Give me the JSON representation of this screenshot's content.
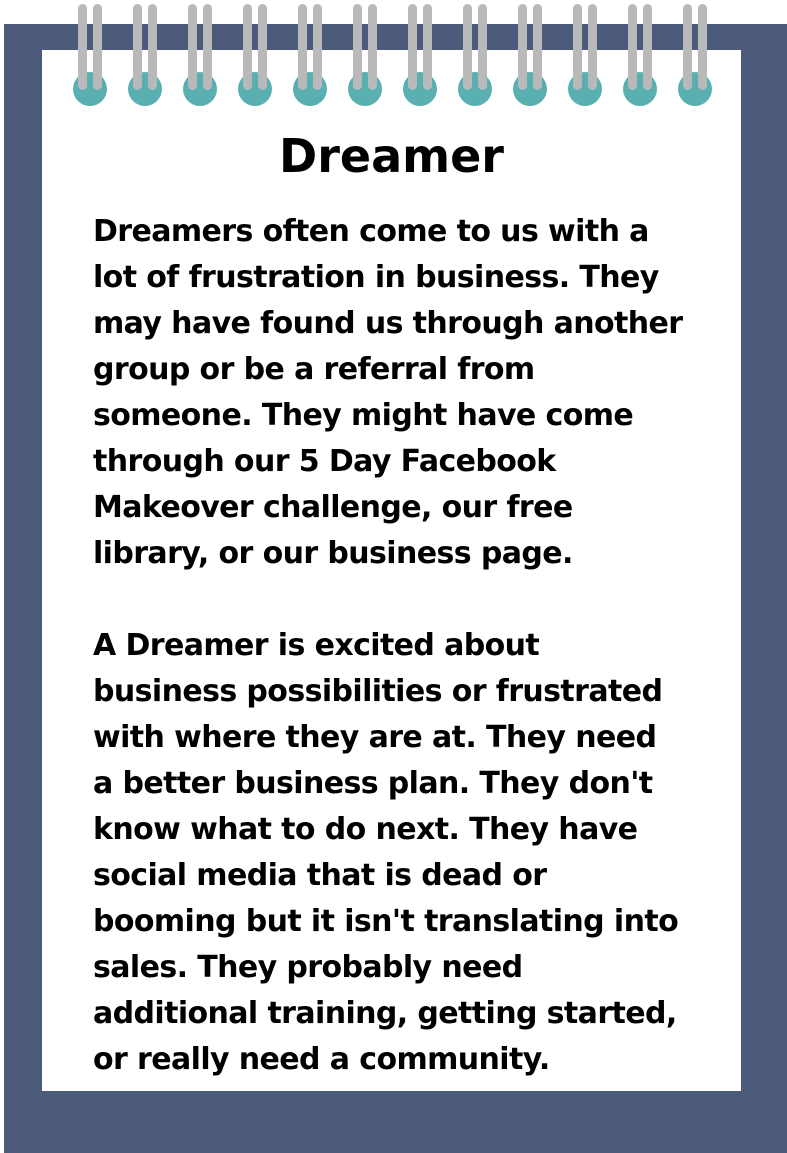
{
  "card": {
    "title": "Dreamer",
    "paragraphs": [
      "Dreamers often come to us with a\nlot of frustration in business. They\nmay have found us through another\ngroup or be a referral from\nsomeone.  They might have come\nthrough our 5 Day Facebook\nMakeover challenge, our free\nlibrary, or our business page.",
      "A Dreamer is excited about\nbusiness possibilities or frustrated\nwith where they are at. They need\na better business plan. They don't\nknow what to do next. They have\nsocial media that is dead or\nbooming but it isn't translating into\nsales. They probably need\nadditional training, getting started,\nor really need a community."
    ]
  },
  "colors": {
    "frame": "#4c5a7b",
    "paper": "#ffffff",
    "ring_hole": "#5ab0b0",
    "ring_wire": "#b9b9b9",
    "text": "#000000"
  },
  "decorations": {
    "spiral_binding_rings": 12
  }
}
